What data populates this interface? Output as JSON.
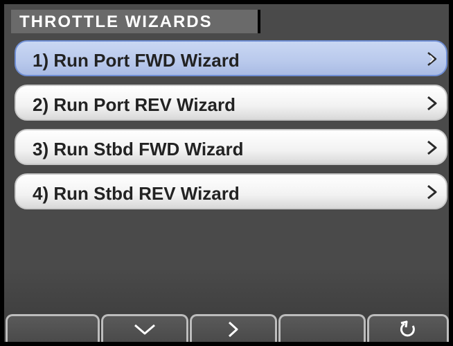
{
  "title": "THROTTLE WIZARDS",
  "menu": {
    "items": [
      {
        "label": "1) Run Port FWD Wizard",
        "selected": true,
        "icon": "chevron-right-outline-icon"
      },
      {
        "label": "2) Run Port REV Wizard",
        "selected": false,
        "icon": "chevron-right-icon"
      },
      {
        "label": "3) Run Stbd FWD Wizard",
        "selected": false,
        "icon": "chevron-right-icon"
      },
      {
        "label": "4) Run Stbd REV Wizard",
        "selected": false,
        "icon": "chevron-right-icon"
      }
    ]
  },
  "softkeys": [
    {
      "name": "softkey-1",
      "icon": ""
    },
    {
      "name": "softkey-down",
      "icon": "chevron-down-icon"
    },
    {
      "name": "softkey-enter",
      "icon": "chevron-right-icon"
    },
    {
      "name": "softkey-4",
      "icon": ""
    },
    {
      "name": "softkey-back",
      "icon": "return-icon"
    }
  ],
  "colors": {
    "background": "#4a4a4a",
    "selected": "#b9c9ec",
    "item": "#f2f2f2"
  }
}
